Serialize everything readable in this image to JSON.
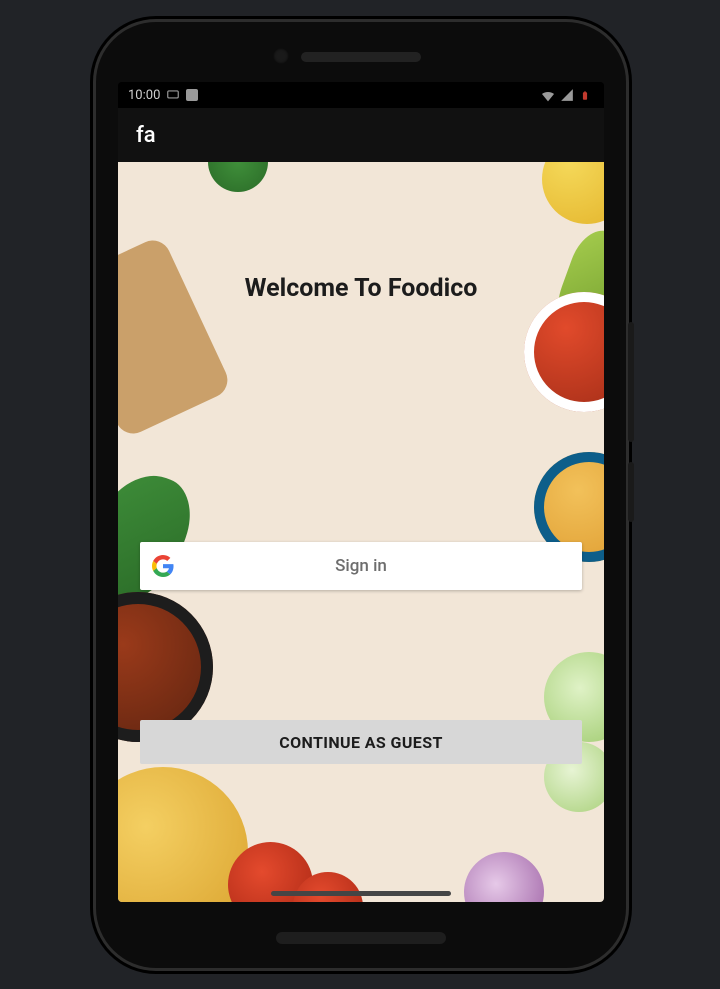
{
  "statusbar": {
    "time": "10:00"
  },
  "appbar": {
    "title": "fa"
  },
  "welcome": {
    "heading": "Welcome To Foodico"
  },
  "auth": {
    "signin_label": "Sign in",
    "guest_label": "CONTINUE AS GUEST"
  }
}
